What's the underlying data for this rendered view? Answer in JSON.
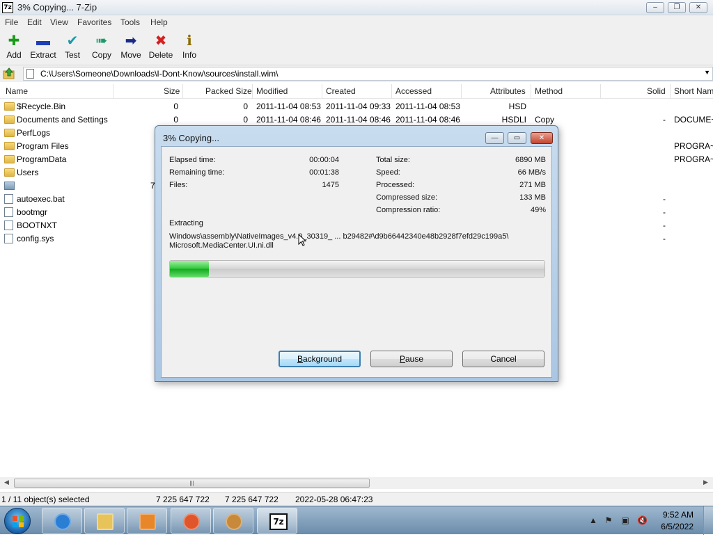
{
  "window": {
    "title": "3% Copying... 7-Zip",
    "app_icon_text": "7z",
    "minimize": "–",
    "restore": "❐",
    "close": "✕"
  },
  "menu": [
    "File",
    "Edit",
    "View",
    "Favorites",
    "Tools",
    "Help"
  ],
  "toolbar": [
    {
      "label": "Add",
      "icon": "plus-icon",
      "glyph": "✚",
      "color": "#1a9a1a"
    },
    {
      "label": "Extract",
      "icon": "minus-icon",
      "glyph": "▬",
      "color": "#1e3fb5"
    },
    {
      "label": "Test",
      "icon": "checkmark-icon",
      "glyph": "✔",
      "color": "#1b9aa8"
    },
    {
      "label": "Copy",
      "icon": "double-arrow-icon",
      "glyph": "➠",
      "color": "#1b9a6a"
    },
    {
      "label": "Move",
      "icon": "arrow-right-icon",
      "glyph": "➡",
      "color": "#1a2a8a"
    },
    {
      "label": "Delete",
      "icon": "x-icon",
      "glyph": "✖",
      "color": "#d42020"
    },
    {
      "label": "Info",
      "icon": "info-icon",
      "glyph": "ℹ",
      "color": "#8a6a00"
    }
  ],
  "address": {
    "path": "C:\\Users\\Someone\\Downloads\\I-Dont-Know\\sources\\install.wim\\",
    "dropdown_glyph": "▼",
    "up_glyph": "⇧"
  },
  "columns": [
    "Name",
    "Size",
    "Packed Size",
    "Modified",
    "Created",
    "Accessed",
    "Attributes",
    "Method",
    "Solid",
    "Short Nam"
  ],
  "files": [
    {
      "icon": "folder",
      "name": "$Recycle.Bin",
      "size": "0",
      "packed": "0",
      "modified": "2011-11-04 08:53",
      "created": "2011-11-04 09:33",
      "accessed": "2011-11-04 08:53",
      "attributes": "HSD",
      "method": "",
      "solid": "",
      "short": ""
    },
    {
      "icon": "folder",
      "name": "Documents and Settings",
      "size": "0",
      "packed": "0",
      "modified": "2011-11-04 08:46",
      "created": "2011-11-04 08:46",
      "accessed": "2011-11-04 08:46",
      "attributes": "HSDLI",
      "method": "Copy",
      "solid": "-",
      "short": "DOCUME~"
    },
    {
      "icon": "folder",
      "name": "PerfLogs",
      "size": "",
      "packed": "",
      "modified": "",
      "created": "",
      "accessed": "",
      "attributes": "",
      "method": "",
      "solid": "",
      "short": ""
    },
    {
      "icon": "folder",
      "name": "Program Files",
      "size": "28 5",
      "packed": "",
      "modified": "",
      "created": "",
      "accessed": "",
      "attributes": "",
      "method": "",
      "solid": "",
      "short": "PROGRA~"
    },
    {
      "icon": "folder",
      "name": "ProgramData",
      "size": "84 9",
      "packed": "",
      "modified": "",
      "created": "",
      "accessed": "",
      "attributes": "",
      "method": "",
      "solid": "",
      "short": "PROGRA~"
    },
    {
      "icon": "folder",
      "name": "Users",
      "size": "2",
      "packed": "",
      "modified": "",
      "created": "",
      "accessed": "",
      "attributes": "",
      "method": "",
      "solid": "",
      "short": ""
    },
    {
      "icon": "disk",
      "name": "",
      "size": "7 225 6",
      "packed": "",
      "modified": "",
      "created": "",
      "accessed": "",
      "attributes": "",
      "method": "",
      "solid": "",
      "short": ""
    },
    {
      "icon": "file",
      "name": "autoexec.bat",
      "size": "",
      "packed": "",
      "modified": "",
      "created": "",
      "accessed": "",
      "attributes": "",
      "method": "",
      "solid": "-",
      "short": ""
    },
    {
      "icon": "file",
      "name": "bootmgr",
      "size": "3",
      "packed": "",
      "modified": "",
      "created": "",
      "accessed": "",
      "attributes": "",
      "method": "",
      "solid": "-",
      "short": ""
    },
    {
      "icon": "file",
      "name": "BOOTNXT",
      "size": "",
      "packed": "",
      "modified": "",
      "created": "",
      "accessed": "",
      "attributes": "",
      "method": "",
      "solid": "-",
      "short": ""
    },
    {
      "icon": "file",
      "name": "config.sys",
      "size": "",
      "packed": "",
      "modified": "",
      "created": "",
      "accessed": "",
      "attributes": "",
      "method": "",
      "solid": "-",
      "short": ""
    }
  ],
  "scrollbar": {
    "left_glyph": "◀",
    "right_glyph": "▶",
    "grip": "|||"
  },
  "status": {
    "selection": "1 / 11 object(s) selected",
    "size": "7 225 647 722",
    "packed": "7 225 647 722",
    "date": "2022-05-28 06:47:23"
  },
  "dialog": {
    "title": "3% Copying...",
    "minimize": "—",
    "restore": "▭",
    "close": "✕",
    "elapsed_label": "Elapsed time:",
    "elapsed_value": "00:00:04",
    "remaining_label": "Remaining time:",
    "remaining_value": "00:01:38",
    "files_label": "Files:",
    "files_value": "1475",
    "total_label": "Total size:",
    "total_value": "6890 MB",
    "speed_label": "Speed:",
    "speed_value": "66 MB/s",
    "processed_label": "Processed:",
    "processed_value": "271 MB",
    "compressed_label": "Compressed size:",
    "compressed_value": "133 MB",
    "ratio_label": "Compression ratio:",
    "ratio_value": "49%",
    "operation": "Extracting",
    "path_line1": "Windows\\assembly\\NativeImages_v4.0_30319_ ... b29482#\\d9b66442340e48b2928f7efd29c199a5\\",
    "path_line2": "Microsoft.MediaCenter.UI.ni.dll",
    "progress": 0.03,
    "btn_background_ul": "B",
    "btn_background_rest": "ackground",
    "btn_pause_ul": "P",
    "btn_pause_rest": "ause",
    "btn_cancel": "Cancel"
  },
  "taskbar": {
    "time": "9:52 AM",
    "date": "6/5/2022",
    "apps": [
      {
        "name": "internet-explorer",
        "color": "#2a7fd4"
      },
      {
        "name": "file-explorer",
        "color": "#e8c35a"
      },
      {
        "name": "media-player",
        "color": "#e8872a"
      },
      {
        "name": "firefox",
        "color": "#e0552a"
      },
      {
        "name": "burn-tool",
        "color": "#c88a3a"
      },
      {
        "name": "7-zip",
        "color": "#111111"
      }
    ],
    "seven_zip_label": "7z",
    "tray_up": "▲",
    "tray_flag": "⚑",
    "tray_network": "▣",
    "tray_volume": "🔇"
  }
}
